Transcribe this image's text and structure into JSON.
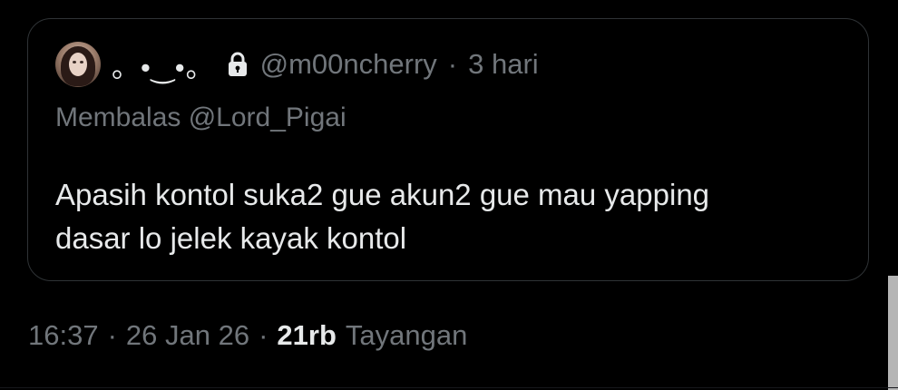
{
  "quoted_tweet": {
    "display_name": "。•‿•。",
    "handle": "@m00ncherry",
    "separator": "·",
    "time_ago": "3 hari",
    "reply_to": "Membalas @Lord_Pigai",
    "text_lines": [
      "Apasih kontol suka2 gue akun2 gue mau yapping",
      "dasar lo jelek kayak kontol"
    ],
    "avatar_icon": "profile-photo",
    "protected_icon": "lock-icon"
  },
  "meta": {
    "time": "16:37",
    "sep1": "·",
    "date": "26 Jan 26",
    "sep2": "·",
    "views_count": "21rb",
    "views_label": "Tayangan"
  },
  "colors": {
    "background": "#000000",
    "primary_text": "#e7e9ea",
    "secondary_text": "#71767b",
    "border": "#2f3336"
  }
}
